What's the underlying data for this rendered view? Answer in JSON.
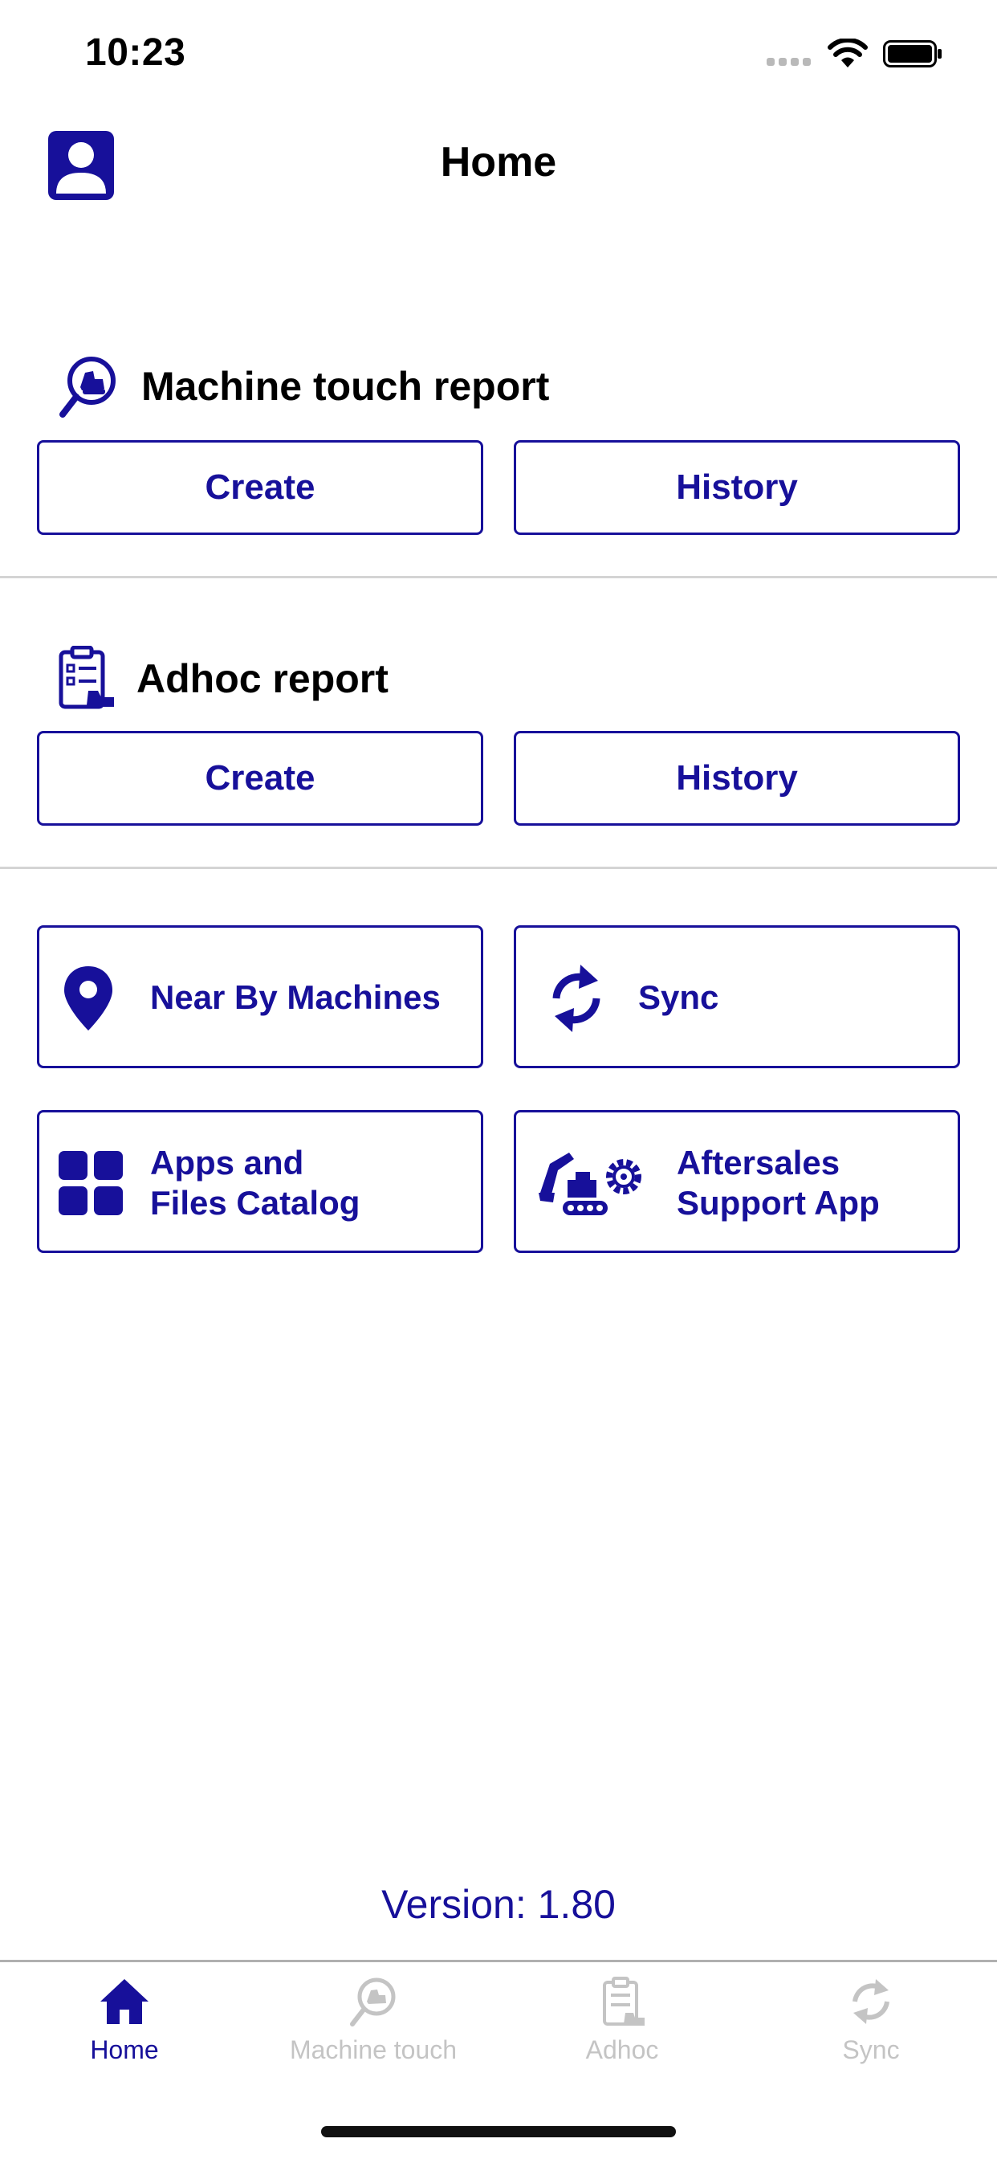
{
  "status_bar": {
    "time": "10:23",
    "icons": [
      "cellular-signal-icon",
      "wifi-icon",
      "battery-icon"
    ]
  },
  "header": {
    "title": "Home",
    "profile_icon": "profile-icon"
  },
  "sections": {
    "machine_touch": {
      "title": "Machine touch report",
      "icon": "machine-search-icon",
      "create_label": "Create",
      "history_label": "History"
    },
    "adhoc": {
      "title": "Adhoc report",
      "icon": "clipboard-report-icon",
      "create_label": "Create",
      "history_label": "History"
    }
  },
  "tiles": {
    "nearby": {
      "label": "Near By Machines",
      "icon": "location-pin-icon"
    },
    "sync": {
      "label": "Sync",
      "icon": "sync-icon"
    },
    "catalog": {
      "label": "Apps and\nFiles Catalog",
      "icon": "grid-icon"
    },
    "aftersales": {
      "label": "Aftersales\nSupport App",
      "icon": "excavator-gear-icon"
    }
  },
  "version": "Version: 1.80",
  "tab_bar": {
    "tabs": [
      {
        "label": "Home",
        "icon": "home-icon",
        "active": true
      },
      {
        "label": "Machine touch",
        "icon": "machine-search-icon",
        "active": false
      },
      {
        "label": "Adhoc",
        "icon": "clipboard-report-icon",
        "active": false
      },
      {
        "label": "Sync",
        "icon": "sync-icon",
        "active": false
      }
    ]
  },
  "colors": {
    "accent": "#17109a",
    "inactive": "#c4c4c4",
    "divider": "#d4d4d4"
  }
}
